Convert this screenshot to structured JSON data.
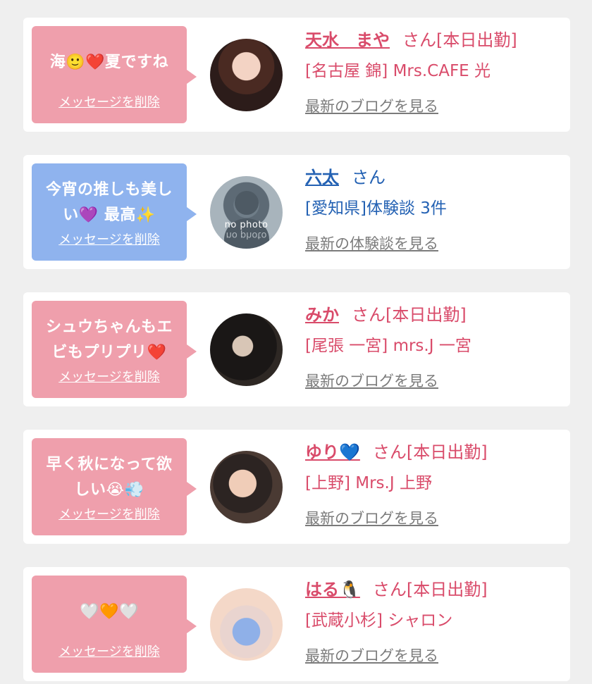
{
  "cards": [
    {
      "msg_line1": "海🙂❤️夏ですね",
      "msg_line2": "",
      "delete_label": "メッセージを削除",
      "name": "天水　まや",
      "san": "さん[本日出勤]",
      "shop": "[名古屋 錦] Mrs.CAFE 光",
      "blog": "最新のブログを見る"
    },
    {
      "msg_line1": "今宵の推しも美し",
      "msg_line2": "い💜 最高✨",
      "delete_label": "メッセージを削除",
      "name": "六太",
      "san": "さん",
      "shop": "[愛知県]体験談 3件",
      "blog": "最新の体験談を見る",
      "avatar_text": "no photo"
    },
    {
      "msg_line1": "シュウちゃんもエ",
      "msg_line2": "ビもプリプリ❤️",
      "delete_label": "メッセージを削除",
      "name": "みか",
      "san": "さん[本日出勤]",
      "shop": "[尾張 一宮] mrs.J 一宮",
      "blog": "最新のブログを見る"
    },
    {
      "msg_line1": "早く秋になって欲",
      "msg_line2": "しい😭💨",
      "delete_label": "メッセージを削除",
      "name": "ゆり💙",
      "san": "さん[本日出勤]",
      "shop": "[上野] Mrs.J 上野",
      "blog": "最新のブログを見る"
    },
    {
      "msg_line1": "🤍🧡🤍",
      "msg_line2": "",
      "delete_label": "メッセージを削除",
      "name": "はる🐧",
      "san": "さん[本日出勤]",
      "shop": "[武蔵小杉] シャロン",
      "blog": "最新のブログを見る"
    }
  ],
  "colors": {
    "page_bg": "#efefef",
    "bubble_pink": "#ef9fac",
    "bubble_blue": "#8fb3ee",
    "name_pink": "#d94b6a",
    "name_blue": "#2361b3",
    "link_gray": "#7b7b7b"
  }
}
